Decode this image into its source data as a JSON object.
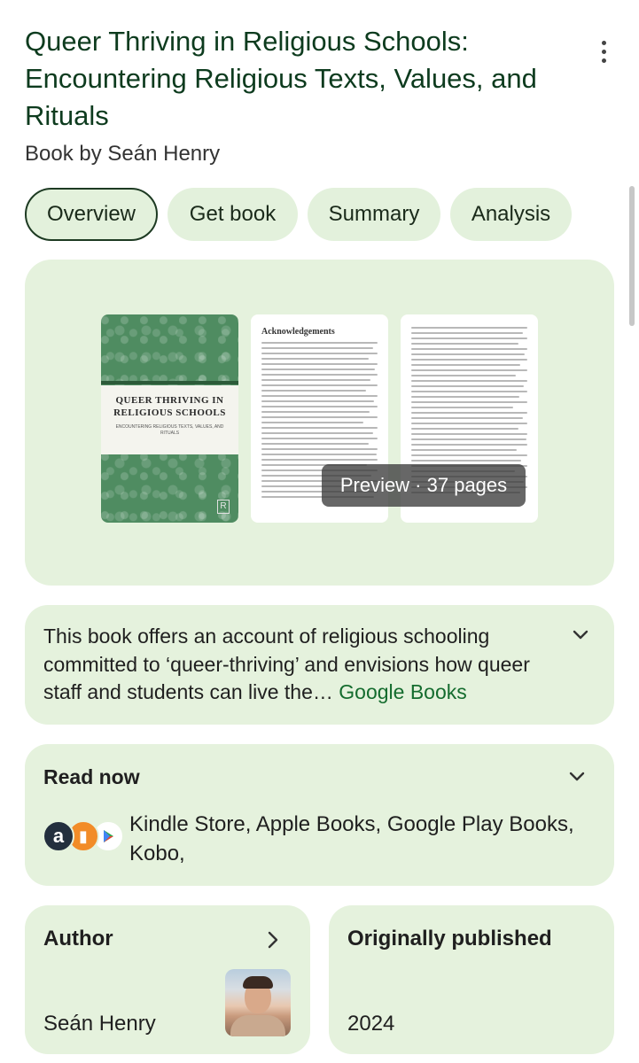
{
  "header": {
    "title": "Queer Thriving in Religious Schools: Encountering Religious Texts, Values, and Rituals",
    "subtitle": "Book by Seán Henry"
  },
  "tabs": [
    {
      "label": "Overview",
      "active": true
    },
    {
      "label": "Get book",
      "active": false
    },
    {
      "label": "Summary",
      "active": false
    },
    {
      "label": "Analysis",
      "active": false
    }
  ],
  "preview": {
    "badge": "Preview · 37 pages",
    "cover": {
      "title": "QUEER THRIVING IN RELIGIOUS SCHOOLS",
      "subtitle": "ENCOUNTERING RELIGIOUS TEXTS, VALUES, AND RITUALS"
    },
    "page1_heading": "Acknowledgements"
  },
  "description": {
    "text": "This book offers an account of religious schooling committed to ‘queer-thriving’ and envisions how queer staff and students can live the…",
    "source": "Google Books"
  },
  "read_now": {
    "title": "Read now",
    "stores": "Kindle Store, Apple Books, Google Play Books, Kobo,"
  },
  "author": {
    "label": "Author",
    "name": "Seán Henry"
  },
  "published": {
    "label": "Originally published",
    "year": "2024"
  },
  "colors": {
    "card_bg": "#e5f2dd",
    "chip_bg": "#e3f1dc",
    "title_color": "#0d3b1e",
    "link_color": "#146c2e"
  }
}
